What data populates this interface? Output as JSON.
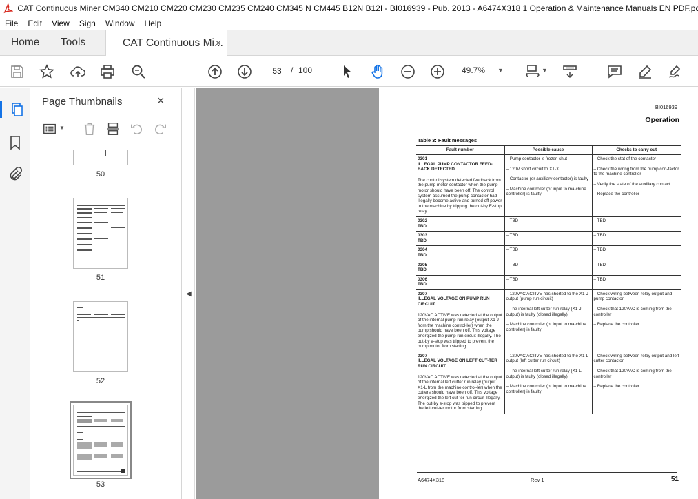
{
  "window": {
    "title": "CAT Continuous Miner CM340 CM210 CM220 CM230 CM235 CM240 CM345 N CM445 B12N B12I - BI016939 - Pub. 2013 - A6474X318 1 Operation & Maintenance Manuals EN PDF.pdf - Ado"
  },
  "menu": [
    "File",
    "Edit",
    "View",
    "Sign",
    "Window",
    "Help"
  ],
  "tabs": {
    "home": "Home",
    "tools": "Tools",
    "document": "CAT Continuous Mi...",
    "close": "×"
  },
  "toolbar": {
    "current_page": "53",
    "separator": "/",
    "total_pages": "100",
    "zoom": "49.7%"
  },
  "thumbnails": {
    "title": "Page Thumbnails",
    "close": "×",
    "pages": [
      "50",
      "51",
      "52",
      "53"
    ],
    "selected": "53"
  },
  "page": {
    "doc_code": "BI016939",
    "section": "Operation",
    "table_title": "Table 3: Fault messages",
    "headers": [
      "Fault number",
      "Possible cause",
      "Checks to carry out"
    ],
    "rows": [
      {
        "code": "0301",
        "name": "ILLEGAL PUMP CONTACTOR FEED-BACK DETECTED",
        "desc": "The control system detected feedback from the pump motor contactor when the pump motor should have been off. The control system assumed the pump contactor had illegally become active and turned off power to the machine by tripping the out-by E-stop relay",
        "causes": [
          "– Pump contactor is frozen shut",
          "– 120V short circuit to X1-X",
          "– Contactor (or auxiliary contactor) is faulty",
          "– Machine controller (or input to ma-chine controller) is faulty"
        ],
        "checks": [
          "– Check the stat of the contactor",
          "– Check the wiring from the pump con-tactor to the machine controller",
          "– Verify the state of the auxiliary contact",
          "– Replace the controller"
        ]
      },
      {
        "code": "0302",
        "name": "TBD",
        "desc": "",
        "causes": [
          "– TBD"
        ],
        "checks": [
          "– TBD"
        ]
      },
      {
        "code": "0303",
        "name": "TBD",
        "desc": "",
        "causes": [
          "– TBD"
        ],
        "checks": [
          "– TBD"
        ]
      },
      {
        "code": "0304",
        "name": "TBD",
        "desc": "",
        "causes": [
          "– TBD"
        ],
        "checks": [
          "– TBD"
        ]
      },
      {
        "code": "0305",
        "name": "TBD",
        "desc": "",
        "causes": [
          "– TBD"
        ],
        "checks": [
          "– TBD"
        ]
      },
      {
        "code": "0306",
        "name": "TBD",
        "desc": "",
        "causes": [
          "– TBD"
        ],
        "checks": [
          "– TBD"
        ]
      },
      {
        "code": "0307",
        "name": "ILLEGAL VOLTAGE ON PUMP RUN CIRCUIT",
        "desc": "120VAC ACTIVE was detected at the output of the internal pump run relay (output X1-J from the machine control-ler) when the pump should have been off. This voltage energized the pump run circuit illegally. The out-by e-stop was tripped to prevent the pump motor from starting",
        "causes": [
          "– 120VAC ACTIVE has shorted to the X1-J output (pump run circuit)",
          "– The internal left cutter run relay (X1-J output) is faulty (closed illegally)",
          "– Machine controller (or input to ma-chine controller) is faulty"
        ],
        "checks": [
          "– Check wiring between relay output and pump contactor",
          "– Check that 120VAC is coming from the controller",
          "– Replace the controller"
        ]
      },
      {
        "code": "0307",
        "name": "ILLEGAL VOLTAGE ON LEFT CUT-TER RUN CIRCUIT",
        "desc": "120VAC ACTIVE was detected at the output of the internal left cutter run relay (output X1-L from the machine control-ler) when the cutters should have been off. This voltage energized the left cut-ter run circuit illegally. The out-by e-stop was tripped to prevent the left cut-ter motor from starting",
        "causes": [
          "– 120VAC ACTIVE has shorted to the X1-L output (left cutter run circuit)",
          "– The internal left cutter run relay (X1-L output) is faulty (closed illegally)",
          "– Machine controller (or input to ma-chine controller) is faulty"
        ],
        "checks": [
          "– Check wiring between relay output and left cutter contactor",
          "– Check that 120VAC is coming from the controller",
          "– Replace the controller"
        ]
      }
    ],
    "footer_left": "A6474X318",
    "footer_mid": "Rev 1",
    "footer_right": "51"
  },
  "icons": {
    "app": "acrobat-icon",
    "save": "save-icon",
    "bookmark_star": "star-icon",
    "share": "upload-icon",
    "print": "print-icon",
    "find": "magnify-icon",
    "prev": "arrow-up-icon",
    "next": "arrow-down-icon",
    "select": "cursor-icon",
    "hand": "hand-icon",
    "zoom_out": "zoom-out-icon",
    "zoom_in": "zoom-in-icon"
  },
  "colors": {
    "accent": "#1473e6",
    "doc_background": "#9b9b9b",
    "acrobat_red": "#d7281e"
  }
}
